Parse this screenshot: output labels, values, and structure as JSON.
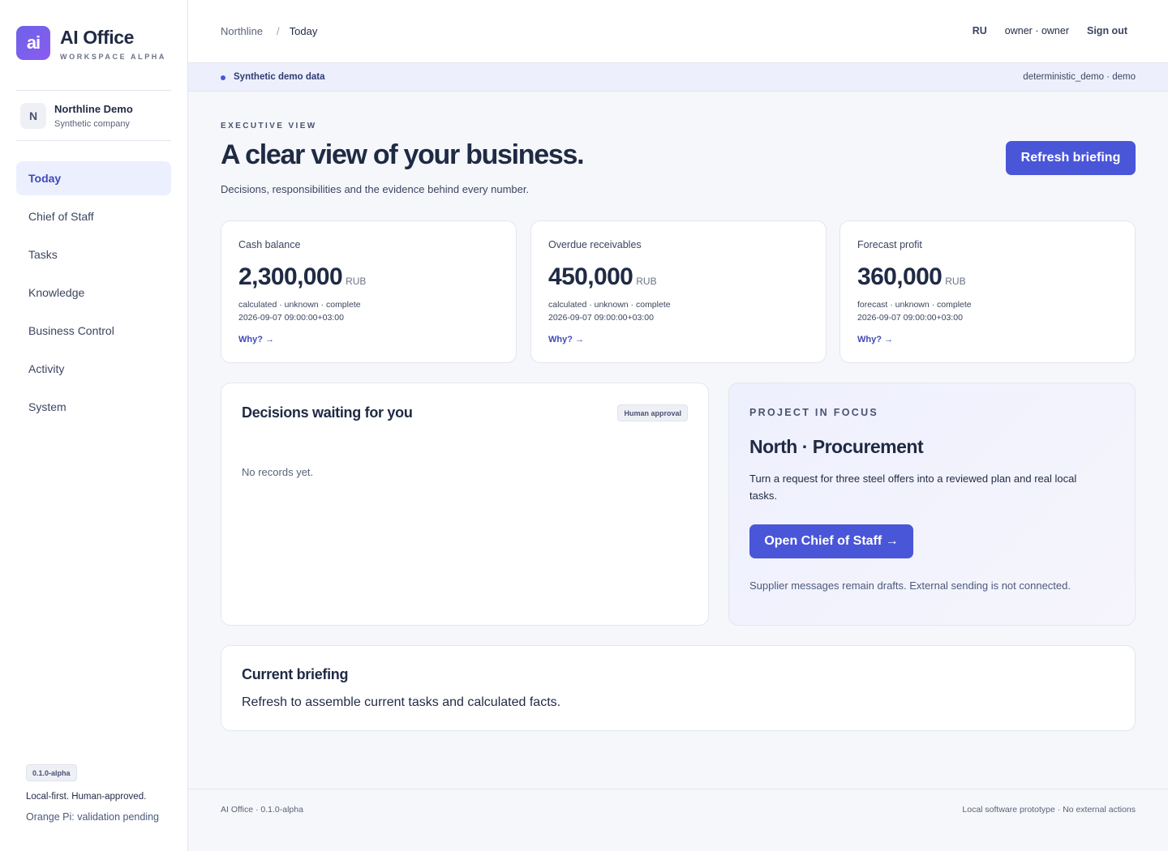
{
  "brand": {
    "logo": "ai",
    "name": "AI Office",
    "subtitle": "WORKSPACE ALPHA"
  },
  "company": {
    "initial": "N",
    "name": "Northline Demo",
    "subtitle": "Synthetic company"
  },
  "sidebar": {
    "items": [
      {
        "label": "Today",
        "active": true
      },
      {
        "label": "Chief of Staff"
      },
      {
        "label": "Tasks"
      },
      {
        "label": "Knowledge"
      },
      {
        "label": "Business Control"
      },
      {
        "label": "Activity"
      },
      {
        "label": "System"
      }
    ],
    "version": "0.1.0-alpha",
    "note1": "Local-first. Human-approved.",
    "note2": "Orange Pi: validation pending"
  },
  "topbar": {
    "breadcrumb": [
      "Northline",
      "Today"
    ],
    "separator": "/",
    "lang": "RU",
    "user": "owner · owner",
    "signout": "Sign out"
  },
  "banner": {
    "label": "Synthetic demo data",
    "right": "deterministic_demo · demo"
  },
  "header": {
    "eyebrow": "EXECUTIVE VIEW",
    "title": "A clear view of your business.",
    "subtitle": "Decisions, responsibilities and the evidence behind every number.",
    "refresh_label": "Refresh briefing"
  },
  "kpis": [
    {
      "label": "Cash balance",
      "value": "2,300,000",
      "unit": "RUB",
      "meta": "calculated · unknown · complete",
      "time": "2026-09-07 09:00:00+03:00",
      "why": "Why? →"
    },
    {
      "label": "Overdue receivables",
      "value": "450,000",
      "unit": "RUB",
      "meta": "calculated · unknown · complete",
      "time": "2026-09-07 09:00:00+03:00",
      "why": "Why? →"
    },
    {
      "label": "Forecast profit",
      "value": "360,000",
      "unit": "RUB",
      "meta": "forecast · unknown · complete",
      "time": "2026-09-07 09:00:00+03:00",
      "why": "Why? →"
    }
  ],
  "decisions": {
    "title": "Decisions waiting for you",
    "badge": "Human approval",
    "empty": "No records yet."
  },
  "focus": {
    "eyebrow": "PROJECT IN FOCUS",
    "title": "North · Procurement",
    "description": "Turn a request for three steel offers into a reviewed plan and real local tasks.",
    "button": "Open Chief of Staff →",
    "note": "Supplier messages remain drafts. External sending is not connected."
  },
  "briefing": {
    "title": "Current briefing",
    "text": "Refresh to assemble current tasks and calculated facts."
  },
  "footer": {
    "left": "AI Office · 0.1.0-alpha",
    "right": "Local software prototype · No external actions"
  },
  "colors": {
    "accent": "#4a56d8",
    "active_nav_bg": "#eceffd",
    "banner_bg": "#edf0fc"
  }
}
